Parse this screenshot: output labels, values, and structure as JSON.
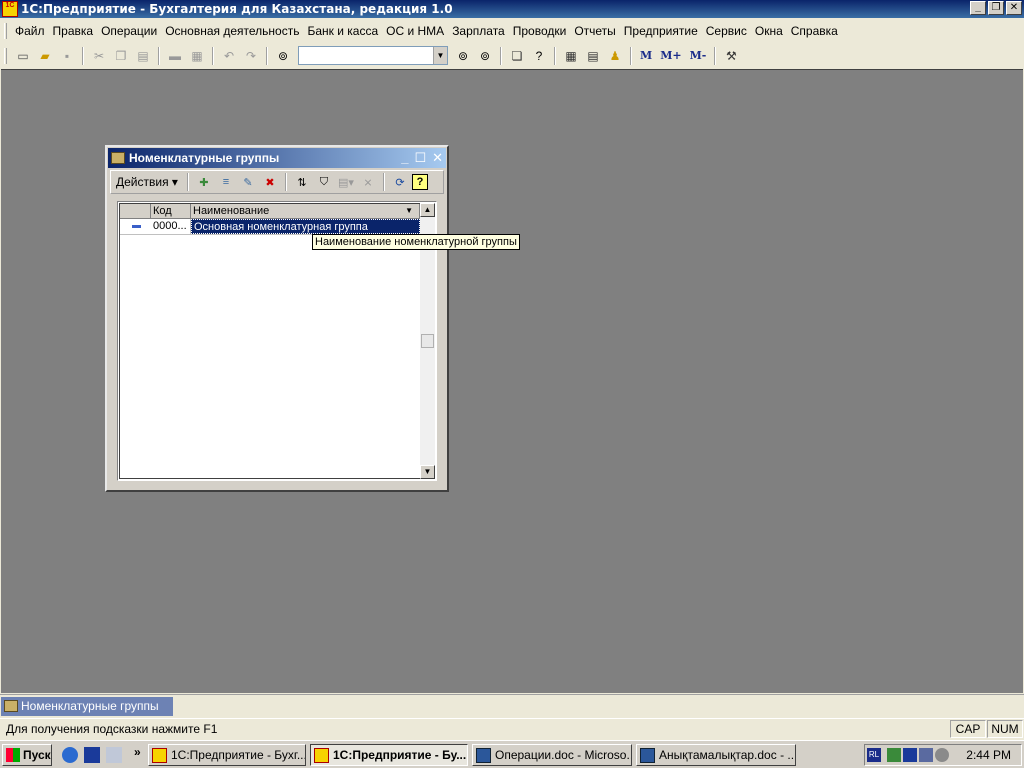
{
  "app": {
    "title": "1С:Предприятие - Бухгалтерия для Казахстана, редакция 1.0",
    "logo_text": "1C"
  },
  "menu": {
    "items": [
      {
        "label": "Файл"
      },
      {
        "label": "Правка"
      },
      {
        "label": "Операции"
      },
      {
        "label": "Основная деятельность"
      },
      {
        "label": "Банк и касса"
      },
      {
        "label": "ОС и НМА"
      },
      {
        "label": "Зарплата"
      },
      {
        "label": "Проводки"
      },
      {
        "label": "Отчеты"
      },
      {
        "label": "Предприятие"
      },
      {
        "label": "Сервис"
      },
      {
        "label": "Окна"
      },
      {
        "label": "Справка"
      }
    ]
  },
  "toolbar": {
    "search_value": "",
    "m_label": "M",
    "m_plus_label": "M+",
    "m_minus_label": "M-"
  },
  "child_window": {
    "title": "Номенклатурные группы",
    "actions_label": "Действия",
    "help_label": "?",
    "columns": {
      "code": "Код",
      "name": "Наименование"
    },
    "rows": [
      {
        "code": "0000...",
        "name": "Основная номенклатурная группа"
      }
    ],
    "tooltip": "Наименование номенклатурной группы"
  },
  "windows_bar": {
    "tab_label": "Номенклатурные группы"
  },
  "statusbar": {
    "hint": "Для получения подсказки нажмите F1",
    "cap": "CAP",
    "num": "NUM"
  },
  "taskbar": {
    "start_label": "Пуск",
    "more": "»",
    "tasks": [
      {
        "label": "1С:Предприятие - Бухг..."
      },
      {
        "label": "1С:Предприятие - Бу..."
      },
      {
        "label": "Операции.doc - Microso..."
      },
      {
        "label": "Анықтамалықтар.doc - ..."
      }
    ],
    "lang": "RL",
    "clock": "2:44 PM"
  },
  "colors": {
    "title_gradient_start": "#0a246a",
    "workspace": "#808080",
    "selection": "#0a246a",
    "tooltip_bg": "#ffffe1"
  }
}
